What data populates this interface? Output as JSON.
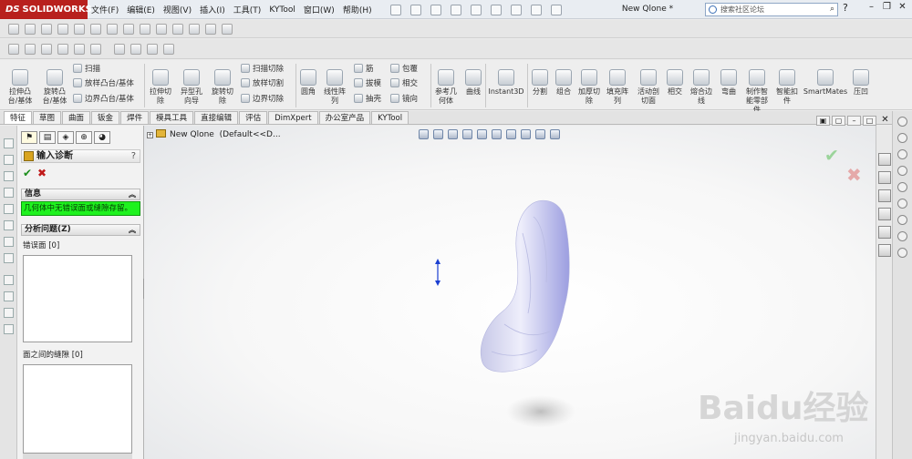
{
  "app": {
    "brand": "SOLIDWORKS",
    "brand_prefix": "DS",
    "document_title": "New Qlone *"
  },
  "menu": [
    "文件(F)",
    "编辑(E)",
    "视图(V)",
    "插入(I)",
    "工具(T)",
    "KYTool",
    "窗口(W)",
    "帮助(H)"
  ],
  "search": {
    "placeholder": "搜索社区论坛"
  },
  "toolbar": {
    "extrude_boss": "拉伸凸\n台/基体",
    "revolve_boss": "旋转凸\n台/基体",
    "sweep": "扫描",
    "loft_boss": "放样凸台/基体",
    "boundary_boss": "边界凸台/基体",
    "extrude_cut": "拉伸切\n除",
    "hole_wizard": "异型孔\n向导",
    "revolve_cut": "旋转切\n除",
    "sweep_cut": "扫描切除",
    "loft_cut": "放样切割",
    "boundary_cut": "边界切除",
    "fillet": "圆角",
    "linear_pattern": "线性阵\n列",
    "rib": "筋",
    "draft": "拔模",
    "shell": "抽壳",
    "wrap": "包覆",
    "intersect": "相交",
    "mirror": "镜向",
    "reference_geometry": "参考几\n何体",
    "curves": "曲线",
    "instant3d": "Instant3D",
    "split": "分割",
    "combine": "组合",
    "thicken_cut": "加厚切\n除",
    "fill_pattern": "填充阵\n列",
    "move_face_cut": "活动剖\n切面",
    "intersect2": "相交",
    "composite_edge": "熔合边\n线",
    "flex": "弯曲",
    "make_part": "制作智\n能零部\n件",
    "smart_fasteners": "智能扣\n件",
    "smartmates": "SmartMates",
    "indent": "压凹"
  },
  "tabs": [
    "特征",
    "草图",
    "曲面",
    "钣金",
    "焊件",
    "模具工具",
    "直接编辑",
    "评估",
    "DimXpert",
    "办公室产品",
    "KYTool"
  ],
  "property_manager": {
    "title": "输入诊断",
    "help": "?",
    "ok_icon": "check-icon",
    "cancel_icon": "x-icon",
    "info_header": "信息",
    "info_message": "几何体中无错误面或缝隙存留。",
    "analyze_header": "分析问题(Z)",
    "faulty_faces_label": "错误面",
    "faulty_faces_count": "[0]",
    "gaps_label": "面之间的缝隙",
    "gaps_count": "[0]"
  },
  "tree": {
    "root": "New Qlone",
    "config": "(Default<<D..."
  },
  "watermark": {
    "brand": "Bai",
    "suffix": "du",
    "cn": "经验",
    "url": "jingyan.baidu.com"
  },
  "colors": {
    "brand_red": "#b8201d",
    "info_green": "#1ef21e",
    "ok_green": "#1d8f1d",
    "cancel_red": "#c01a1a"
  }
}
